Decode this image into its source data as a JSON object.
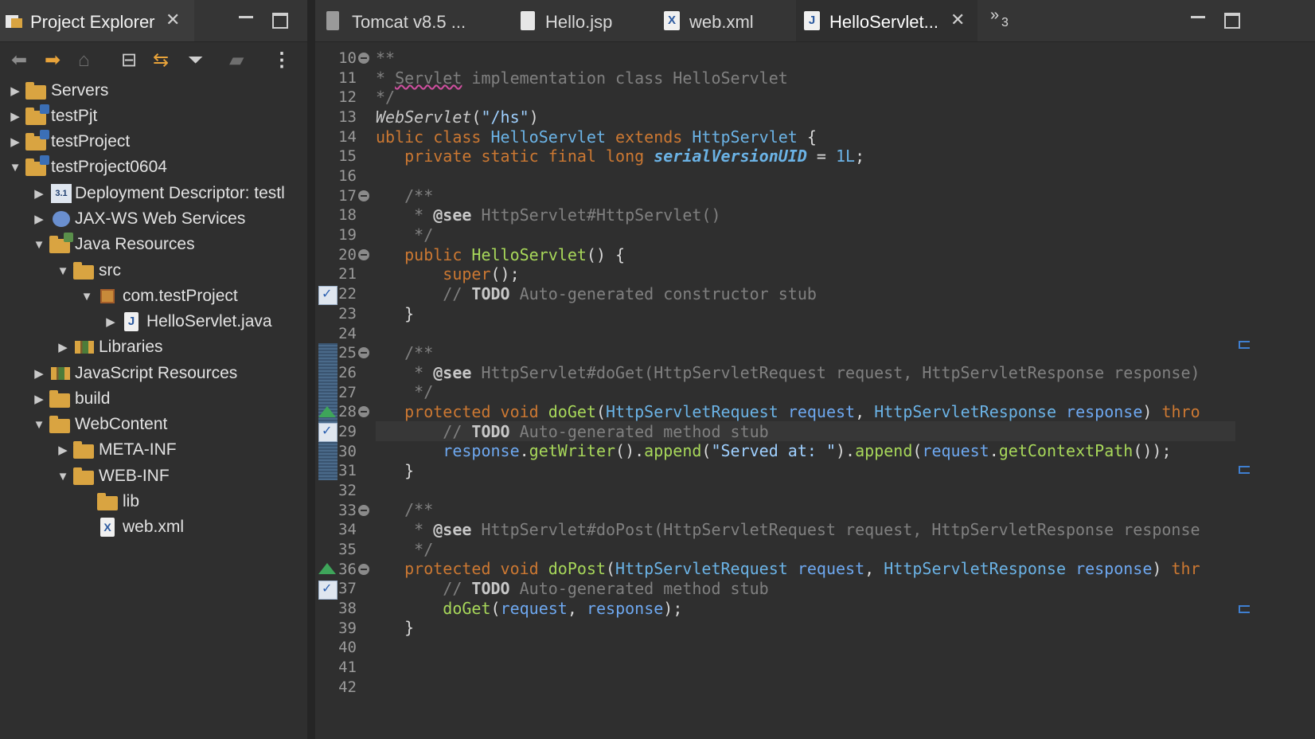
{
  "project_explorer": {
    "title": "Project Explorer",
    "close_icon": "close-icon",
    "minimize_icon": "minimize-icon",
    "maximize_icon": "maximize-icon",
    "toolbar": [
      "back-icon",
      "forward-icon",
      "home-icon",
      "collapse-all-icon",
      "link-with-editor-icon",
      "filter-icon",
      "view-menu-icon",
      "more-icon"
    ],
    "tree": [
      {
        "label": "Servers",
        "depth": 0,
        "expanded": false,
        "icon": "folder-icon"
      },
      {
        "label": "testPjt",
        "depth": 0,
        "expanded": false,
        "icon": "project-icon"
      },
      {
        "label": "testProject",
        "depth": 0,
        "expanded": false,
        "icon": "project-icon"
      },
      {
        "label": "testProject0604",
        "depth": 0,
        "expanded": true,
        "icon": "project-icon"
      },
      {
        "label": "Deployment Descriptor: testl",
        "depth": 1,
        "expanded": false,
        "icon": "deployment-descriptor-icon"
      },
      {
        "label": "JAX-WS Web Services",
        "depth": 1,
        "expanded": false,
        "icon": "web-services-icon"
      },
      {
        "label": "Java Resources",
        "depth": 1,
        "expanded": true,
        "icon": "java-resources-icon"
      },
      {
        "label": "src",
        "depth": 2,
        "expanded": true,
        "icon": "source-folder-icon"
      },
      {
        "label": "com.testProject",
        "depth": 3,
        "expanded": true,
        "icon": "package-icon"
      },
      {
        "label": "HelloServlet.java",
        "depth": 4,
        "expanded": false,
        "icon": "java-file-icon"
      },
      {
        "label": "Libraries",
        "depth": 2,
        "expanded": false,
        "icon": "libraries-icon"
      },
      {
        "label": "JavaScript Resources",
        "depth": 1,
        "expanded": false,
        "icon": "javascript-resources-icon"
      },
      {
        "label": "build",
        "depth": 1,
        "expanded": false,
        "icon": "folder-icon"
      },
      {
        "label": "WebContent",
        "depth": 1,
        "expanded": true,
        "icon": "folder-icon"
      },
      {
        "label": "META-INF",
        "depth": 2,
        "expanded": false,
        "icon": "folder-icon"
      },
      {
        "label": "WEB-INF",
        "depth": 2,
        "expanded": true,
        "icon": "folder-icon"
      },
      {
        "label": "lib",
        "depth": 3,
        "expanded": null,
        "icon": "folder-icon"
      },
      {
        "label": "web.xml",
        "depth": 3,
        "expanded": null,
        "icon": "xml-file-icon"
      }
    ]
  },
  "editor": {
    "tabs": [
      {
        "label": "Tomcat v8.5 ...",
        "icon": "server-icon",
        "active": false
      },
      {
        "label": "Hello.jsp",
        "icon": "jsp-file-icon",
        "active": false
      },
      {
        "label": "web.xml",
        "icon": "xml-file-icon",
        "active": false
      },
      {
        "label": "HelloServlet...",
        "icon": "java-file-icon",
        "active": true
      }
    ],
    "overflow_label": "»",
    "overflow_count": "3",
    "line_numbers": [
      "10",
      "11",
      "12",
      "13",
      "14",
      "15",
      "16",
      "17",
      "18",
      "19",
      "20",
      "21",
      "22",
      "23",
      "24",
      "25",
      "26",
      "27",
      "28",
      "29",
      "30",
      "31",
      "32",
      "33",
      "34",
      "35",
      "36",
      "37",
      "38",
      "39",
      "40",
      "41",
      "42"
    ],
    "code": {
      "l10": "**",
      "l11_a": "* ",
      "l11_b": "Servlet",
      "l11_c": " implementation class HelloServlet",
      "l12": "*/",
      "l13_a": "WebServlet",
      "l13_b": "(",
      "l13_c": "\"/hs\"",
      "l13_d": ")",
      "l14_a": "ublic class ",
      "l14_b": "HelloServlet",
      "l14_c": " extends ",
      "l14_d": "HttpServlet",
      "l14_e": " {",
      "l15_a": "   private static final long ",
      "l15_b": "serialVersionUID",
      "l15_c": " = ",
      "l15_d": "1L",
      "l15_e": ";",
      "l17": "   /**",
      "l18_a": "    * ",
      "l18_b": "@see",
      "l18_c": " HttpServlet#HttpServlet()",
      "l19": "    */",
      "l20_a": "   public ",
      "l20_b": "HelloServlet",
      "l20_c": "() {",
      "l21_a": "       ",
      "l21_b": "super",
      "l21_c": "();",
      "l22_a": "       // ",
      "l22_b": "TODO",
      "l22_c": " Auto-generated constructor stub",
      "l23": "   }",
      "l25": "   /**",
      "l26_a": "    * ",
      "l26_b": "@see",
      "l26_c": " HttpServlet#doGet(HttpServletRequest request, HttpServletResponse response)",
      "l27": "    */",
      "l28_a": "   protected void ",
      "l28_b": "doGet",
      "l28_c": "(",
      "l28_d": "HttpServletRequest",
      "l28_e": " ",
      "l28_f": "request",
      "l28_g": ", ",
      "l28_h": "HttpServletResponse",
      "l28_i": " ",
      "l28_j": "response",
      "l28_k": ") ",
      "l28_l": "thro",
      "l29_a": "       // ",
      "l29_b": "TODO",
      "l29_c": " Auto-generated method stub",
      "l30_a": "       ",
      "l30_b": "response",
      "l30_c": ".",
      "l30_d": "getWriter",
      "l30_e": "().",
      "l30_f": "append",
      "l30_g": "(",
      "l30_h": "\"Served at: \"",
      "l30_i": ").",
      "l30_j": "append",
      "l30_k": "(",
      "l30_l": "request",
      "l30_m": ".",
      "l30_n": "getContextPath",
      "l30_o": "());",
      "l31": "   }",
      "l33": "   /**",
      "l34_a": "    * ",
      "l34_b": "@see",
      "l34_c": " HttpServlet#doPost(HttpServletRequest request, HttpServletResponse response",
      "l35": "    */",
      "l36_a": "   protected void ",
      "l36_b": "doPost",
      "l36_c": "(",
      "l36_d": "HttpServletRequest",
      "l36_e": " ",
      "l36_f": "request",
      "l36_g": ", ",
      "l36_h": "HttpServletResponse",
      "l36_i": " ",
      "l36_j": "response",
      "l36_k": ") ",
      "l36_l": "thr",
      "l37_a": "       // ",
      "l37_b": "TODO",
      "l37_c": " Auto-generated method stub",
      "l38_a": "       ",
      "l38_b": "doGet",
      "l38_c": "(",
      "l38_d": "request",
      "l38_e": ", ",
      "l38_f": "response",
      "l38_g": ");",
      "l39": "   }"
    }
  },
  "colors": {
    "keyword": "#cc7832",
    "type": "#6bb3e6",
    "method": "#a8d85a",
    "comment": "#808080",
    "background": "#2f2f2f"
  }
}
